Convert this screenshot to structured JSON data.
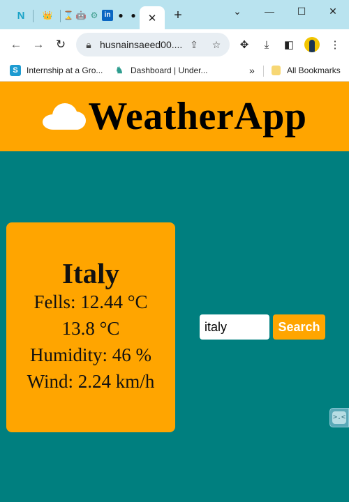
{
  "browser": {
    "tabs": [
      {
        "icon": "notion-n-icon"
      },
      {
        "icon": "crown-icon"
      },
      {
        "icon": "hourglass-icon"
      },
      {
        "icon": "robot-icon"
      },
      {
        "icon": "chatgpt-icon"
      },
      {
        "icon": "linkedin-icon"
      },
      {
        "icon": "github-icon"
      },
      {
        "icon": "github-icon"
      }
    ],
    "active_tab_close": "✕",
    "new_tab": "+",
    "url": "husnainsaeed00....",
    "bookmarks": [
      {
        "label": "Internship at a Gro...",
        "icon": "s-icon",
        "color": "#1d9bd1"
      },
      {
        "label": "Dashboard | Under...",
        "icon": "moose-icon",
        "color": "#2e9d8f"
      }
    ],
    "bookmarks_overflow": "»",
    "all_bookmarks": "All Bookmarks"
  },
  "header": {
    "title": "WeatherApp",
    "icon": "cloud-icon"
  },
  "weather": {
    "city": "Italy",
    "feels": "Fells: 12.44 °C",
    "temp": "13.8 °C",
    "humidity": "Humidity: 46 %",
    "wind": "Wind: 2.24 km/h"
  },
  "search": {
    "value": "italy",
    "button_label": "Search"
  },
  "colors": {
    "background": "#007f7f",
    "accent": "#ffa500"
  }
}
